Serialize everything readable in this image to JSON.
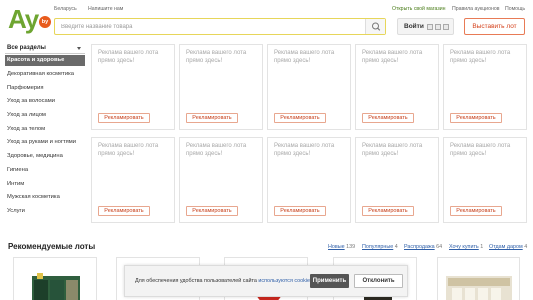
{
  "top_links": {
    "country": "Беларусь",
    "write_us": "Напишите нам",
    "open_shop": "Открыть свой магазин",
    "rules": "Правила аукционов",
    "help": "Помощь"
  },
  "logo": {
    "text": "Ay",
    "badge": "by"
  },
  "search": {
    "placeholder": "Введите название товара"
  },
  "header": {
    "login_label": "Войти",
    "sell_label": "Выставить лот"
  },
  "sidebar": {
    "all_sections": "Все разделы",
    "items": [
      "Красота и здоровье",
      "Декоративная косметика",
      "Парфюмерия",
      "Уход за волосами",
      "Уход за лицом",
      "Уход за телом",
      "Уход за руками и ногтями",
      "Здоровье, медицина",
      "Гигиена",
      "Интим",
      "Мужская косметика",
      "Услуги"
    ],
    "active_index": 0
  },
  "ads": {
    "text": "Реклама вашего лота прямо здесь!",
    "button": "Рекламировать",
    "count": 10
  },
  "recommended": {
    "title": "Рекомендуемые лоты",
    "tabs": [
      {
        "label": "Новые",
        "count": "139"
      },
      {
        "label": "Популярные",
        "count": "4"
      },
      {
        "label": "Распродажа",
        "count": "64"
      },
      {
        "label": "Хочу купить",
        "count": "1"
      },
      {
        "label": "Отдам даром",
        "count": "4"
      }
    ]
  },
  "cookie": {
    "message_prefix": "Для обеспечения удобства пользователей сайта ",
    "message_link": "используются cookies",
    "message_suffix": ".",
    "apply": "Применить",
    "decline": "Отклонить"
  },
  "colors": {
    "brand_green": "#6ea531",
    "accent_orange": "#e85c1d",
    "link_blue": "#2f5fa8"
  }
}
